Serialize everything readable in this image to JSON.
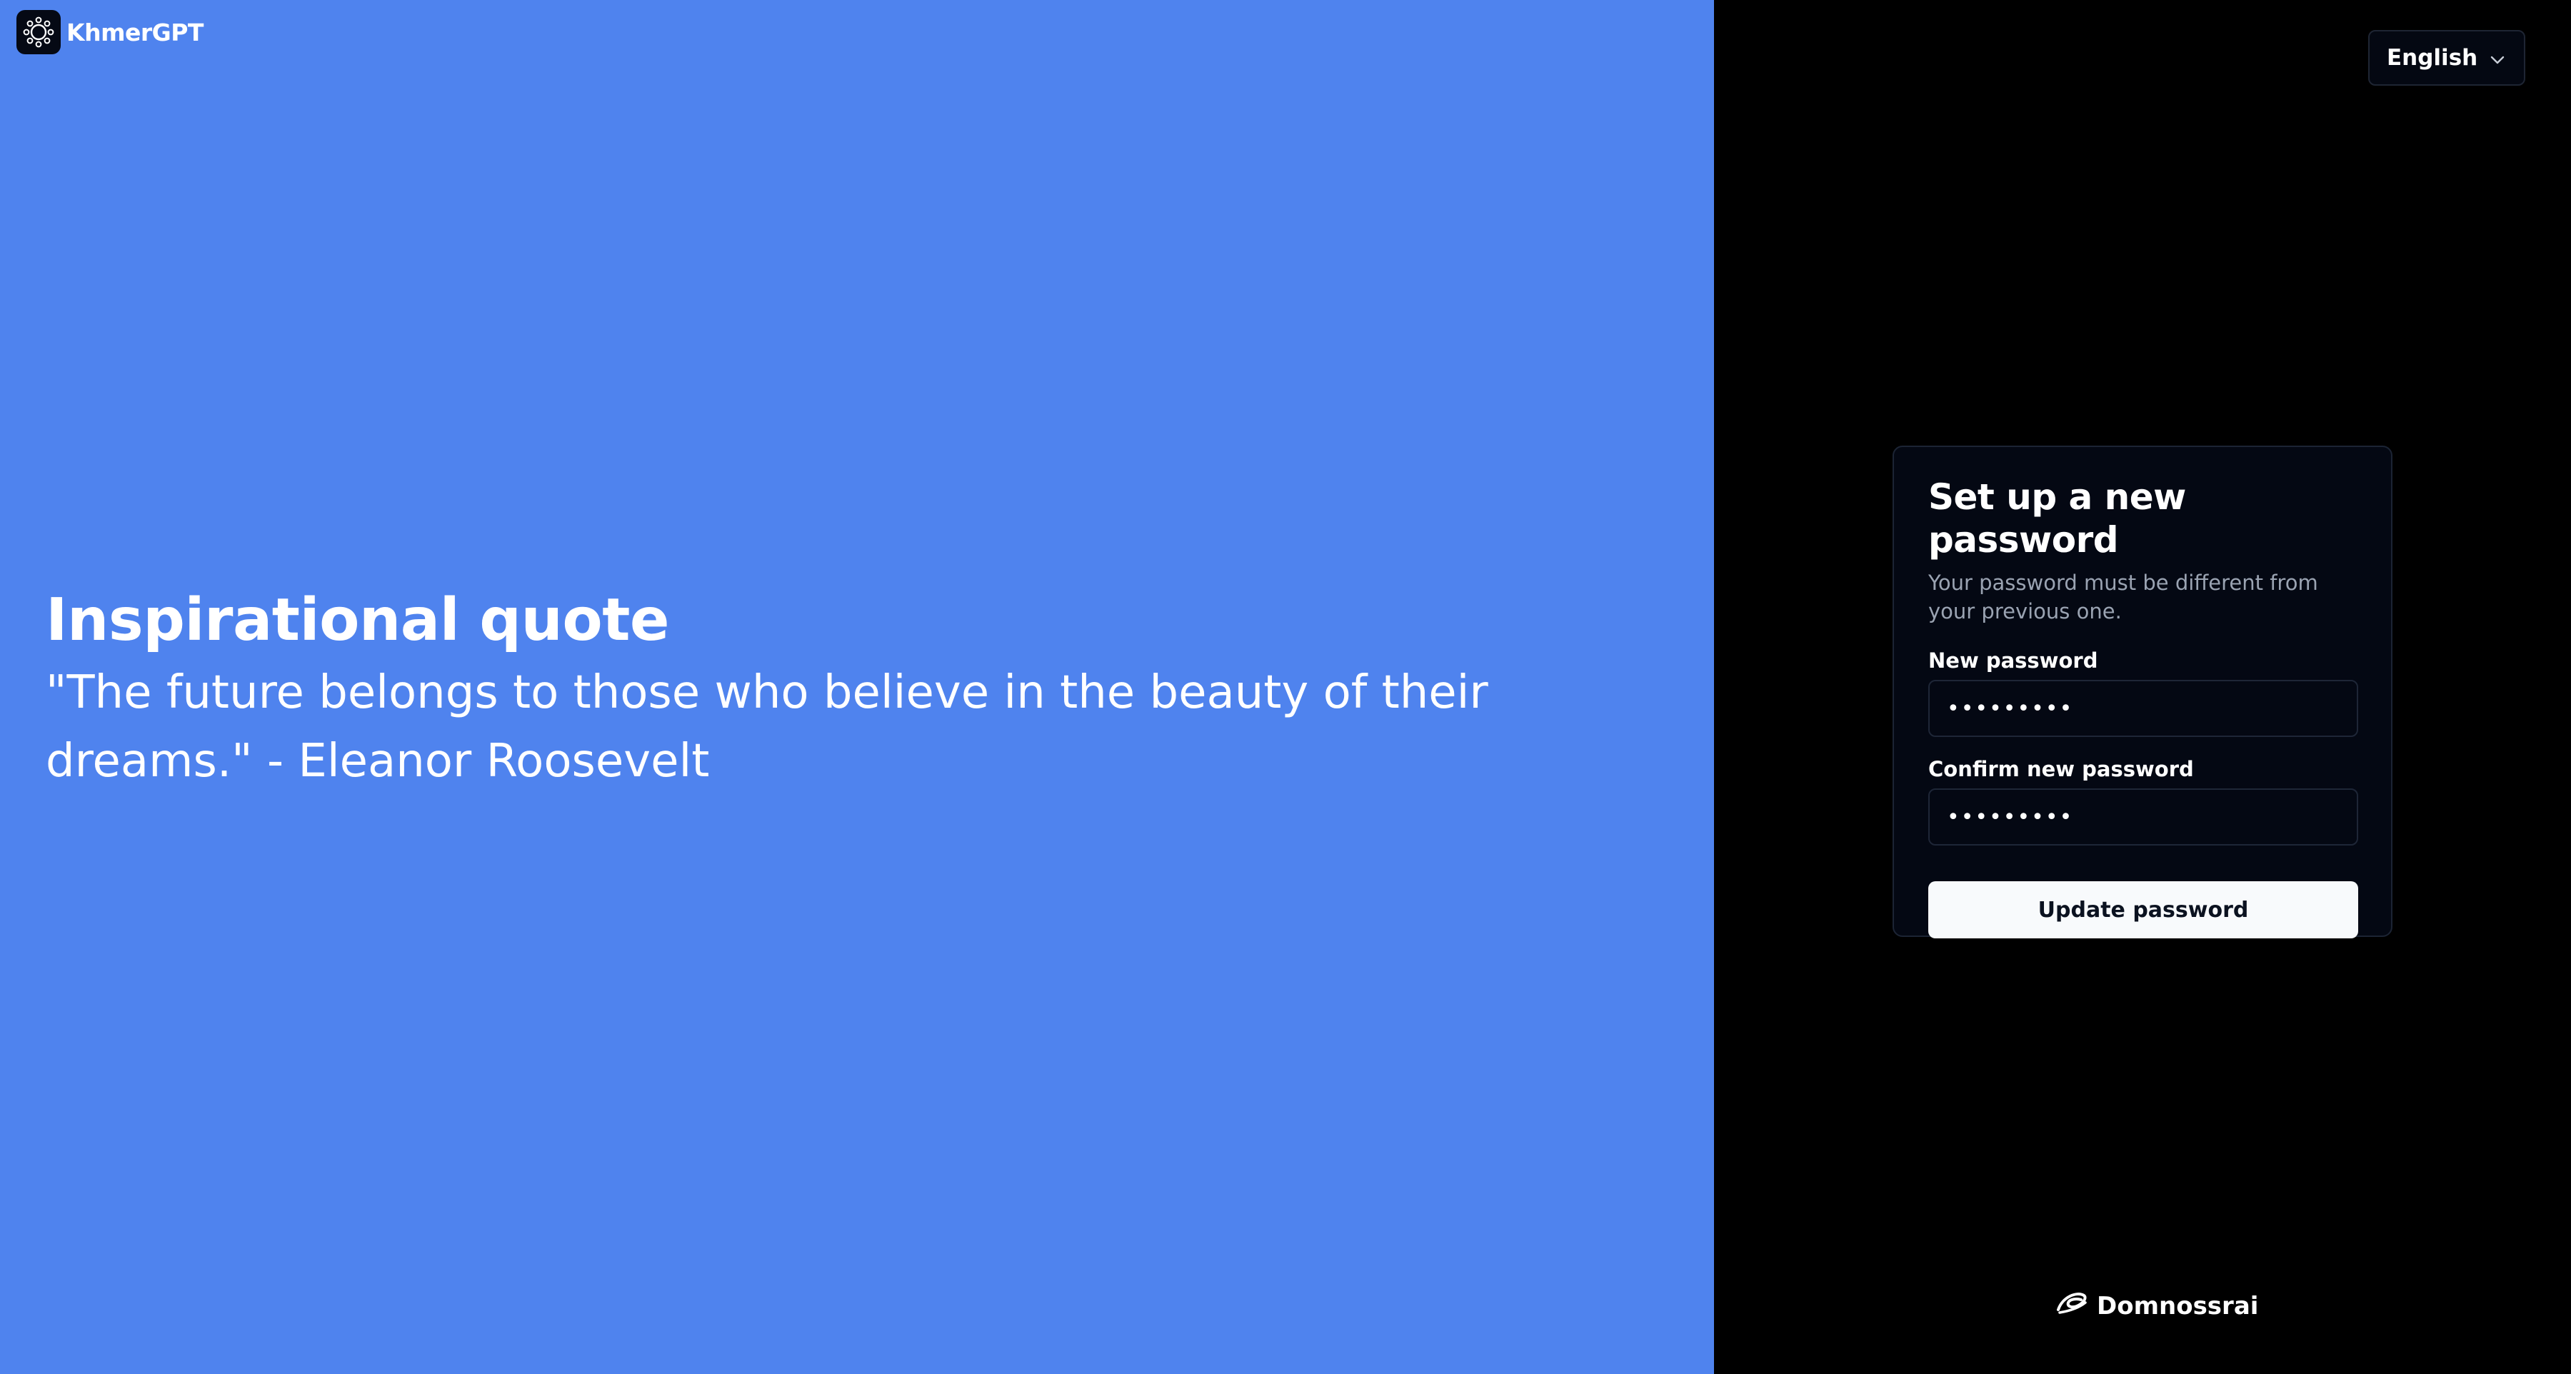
{
  "brand": {
    "name": "KhmerGPT",
    "logo_icon": "gear-flower-icon"
  },
  "quote": {
    "title": "Inspirational quote",
    "text": "\"The future belongs to those who believe in the beauty of their dreams.\" - Eleanor Roosevelt"
  },
  "language": {
    "selected": "English",
    "icon": "chevron-down-icon"
  },
  "form": {
    "title": "Set up a new password",
    "subtitle": "Your password must be different from your previous one.",
    "new_password_label": "New password",
    "new_password_value": "•••••••••",
    "confirm_password_label": "Confirm new password",
    "confirm_password_value": "•••••••••",
    "submit_label": "Update password"
  },
  "footer": {
    "brand_name": "Domnossrai",
    "logo_icon": "swoosh-logo-icon"
  },
  "colors": {
    "left_panel": "#4f83ee",
    "right_panel": "#000000",
    "card_bg": "#040813",
    "button_bg": "#f8fafc"
  }
}
